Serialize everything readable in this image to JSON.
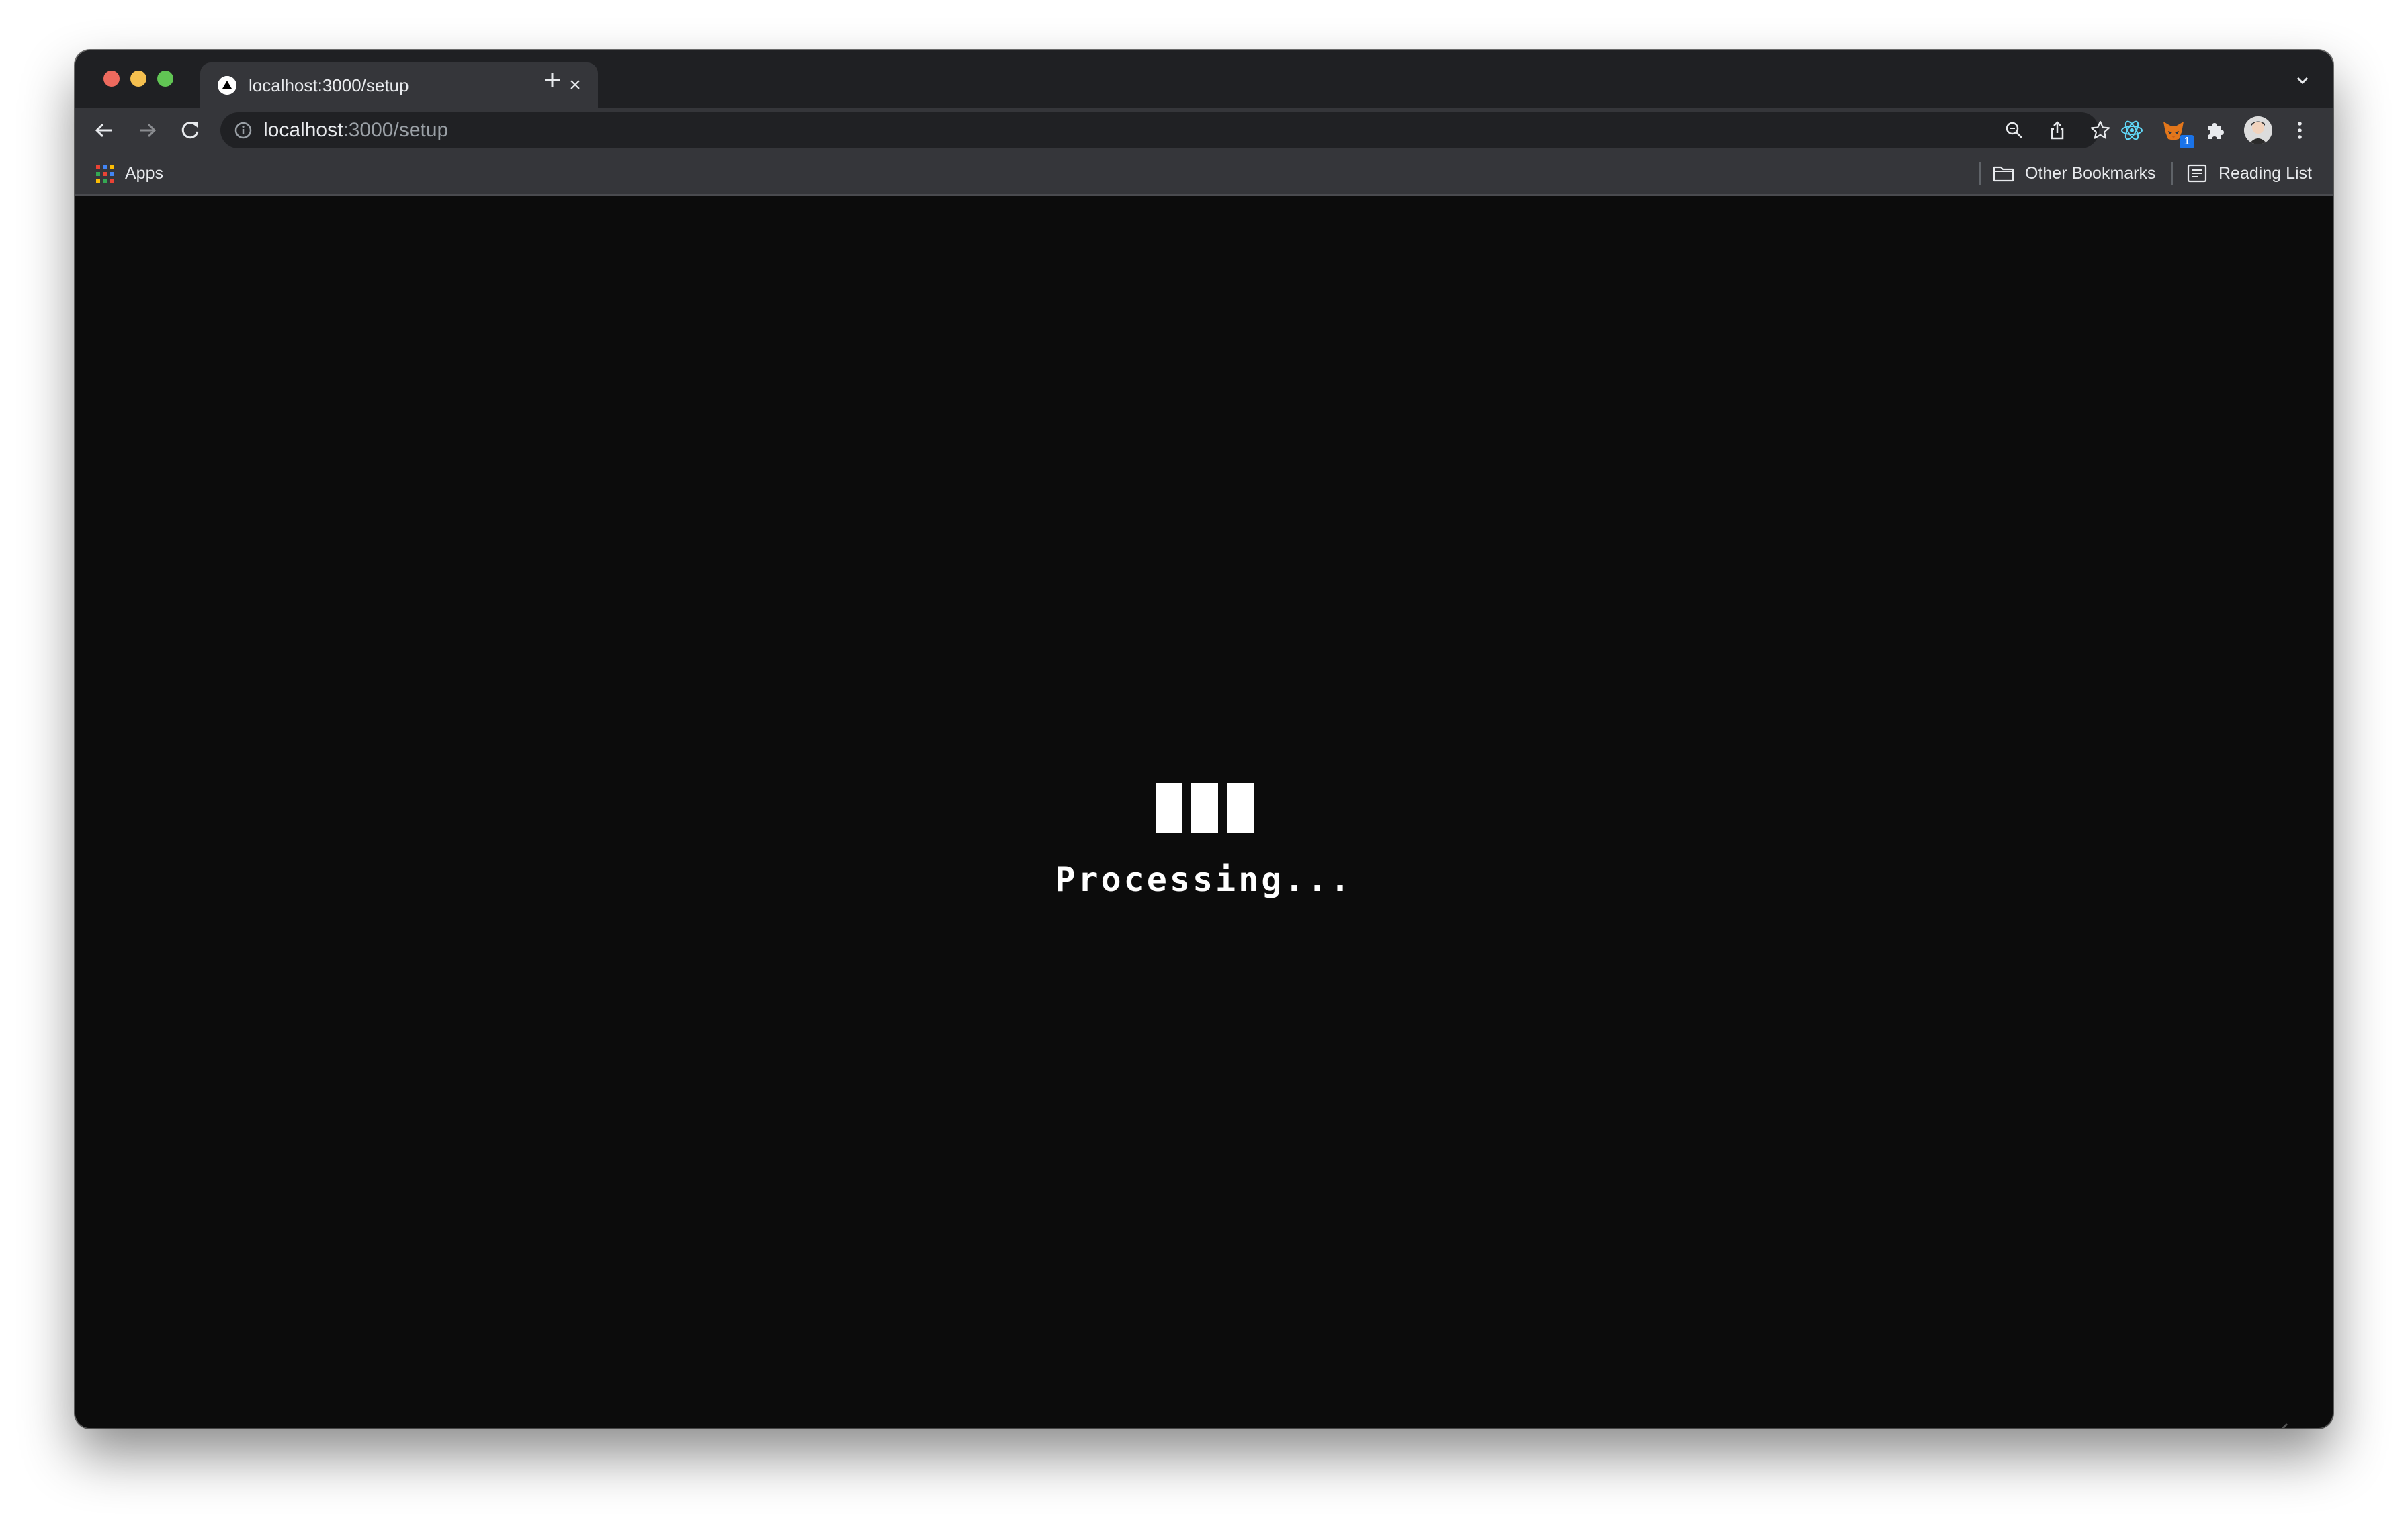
{
  "browser": {
    "tab": {
      "title": "localhost:3000/setup",
      "close_glyph": "×"
    },
    "omnibox": {
      "host": "localhost",
      "path": ":3000/setup"
    },
    "extensions": {
      "badge_count": "1"
    },
    "bookmarks_bar": {
      "apps_label": "Apps",
      "other_bookmarks_label": "Other Bookmarks",
      "reading_list_label": "Reading List"
    }
  },
  "page": {
    "status_text": "Processing...",
    "loader_bar_count": 3
  },
  "colors": {
    "page_background": "#0c0c0c",
    "chrome_frame": "#1f2023",
    "chrome_toolbar": "#35363a",
    "omnibox": "#202124",
    "foreground": "#ffffff"
  }
}
